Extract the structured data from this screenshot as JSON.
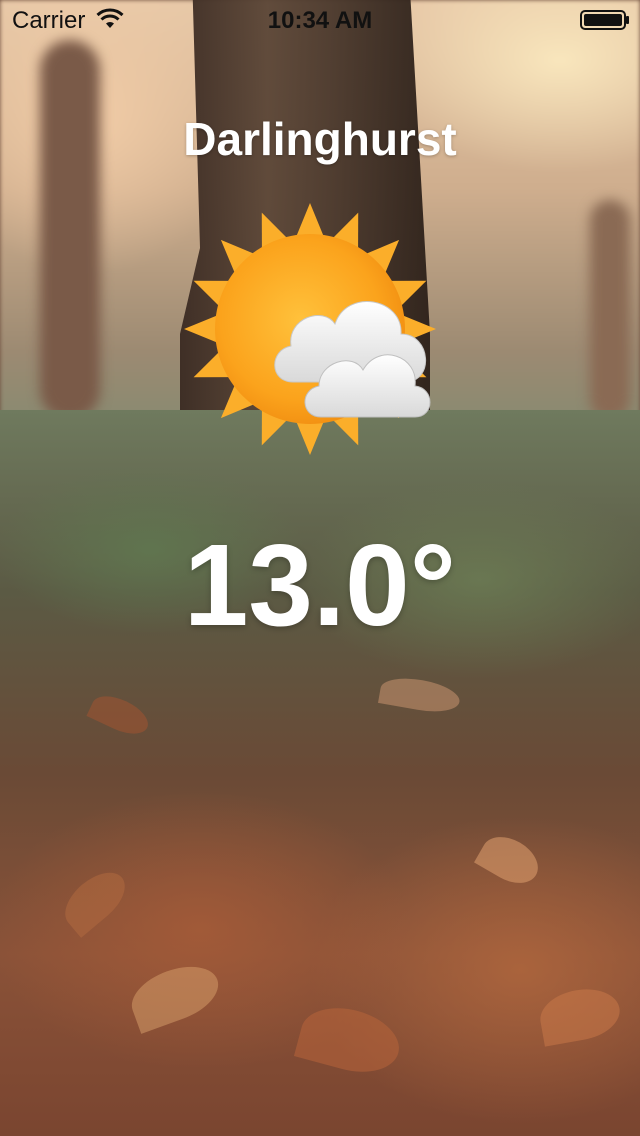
{
  "status_bar": {
    "carrier": "Carrier",
    "time": "10:34 AM",
    "wifi_icon": "wifi-icon",
    "battery_icon": "battery-icon"
  },
  "weather": {
    "city": "Darlinghurst",
    "condition_icon": "partly-cloudy-icon",
    "temperature": "13.0°"
  },
  "colors": {
    "text": "#ffffff",
    "sun": "#f9a825",
    "cloud": "#f2f2f2"
  }
}
